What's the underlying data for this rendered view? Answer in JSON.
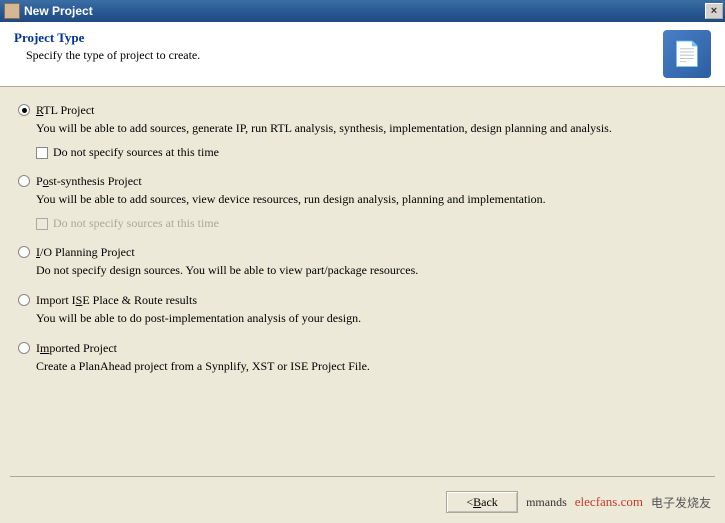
{
  "window": {
    "title": "New Project",
    "close_symbol": "×"
  },
  "header": {
    "title": "Project Type",
    "subtitle": "Specify the type of project to create.",
    "icon_glyph": "📄"
  },
  "options": [
    {
      "id": "rtl",
      "selected": true,
      "label_pre": "",
      "label_ul": "R",
      "label_post": "TL Project",
      "desc": "You will be able to add sources, generate IP, run RTL analysis, synthesis, implementation, design planning and analysis.",
      "checkbox": {
        "present": true,
        "disabled": false,
        "pre": "",
        "ul": "D",
        "post": "o not specify sources at this time"
      }
    },
    {
      "id": "postsynth",
      "selected": false,
      "label_pre": "P",
      "label_ul": "o",
      "label_post": "st-synthesis Project",
      "desc": "You will be able to add sources, view device resources, run design analysis, planning and implementation.",
      "checkbox": {
        "present": true,
        "disabled": true,
        "pre": "Do not ",
        "ul": "s",
        "post": "pecify sources at this time"
      }
    },
    {
      "id": "io",
      "selected": false,
      "label_pre": "",
      "label_ul": "I",
      "label_post": "/O Planning Project",
      "desc": "Do not specify design sources. You will be able to view part/package resources.",
      "checkbox": {
        "present": false
      }
    },
    {
      "id": "ise",
      "selected": false,
      "label_pre": "Import I",
      "label_ul": "S",
      "label_post": "E Place & Route results",
      "desc": "You will be able to do post-implementation analysis of your design.",
      "checkbox": {
        "present": false
      }
    },
    {
      "id": "imported",
      "selected": false,
      "label_pre": "I",
      "label_ul": "m",
      "label_post": "ported Project",
      "desc": "Create a PlanAhead project from a Synplify, XST or ISE Project File.",
      "checkbox": {
        "present": false
      }
    }
  ],
  "buttons": {
    "back_pre": "< ",
    "back_ul": "B",
    "back_post": "ack",
    "next_partial": "mmands",
    "watermark": "elecfans.com",
    "watermark2": "电子发烧友"
  }
}
